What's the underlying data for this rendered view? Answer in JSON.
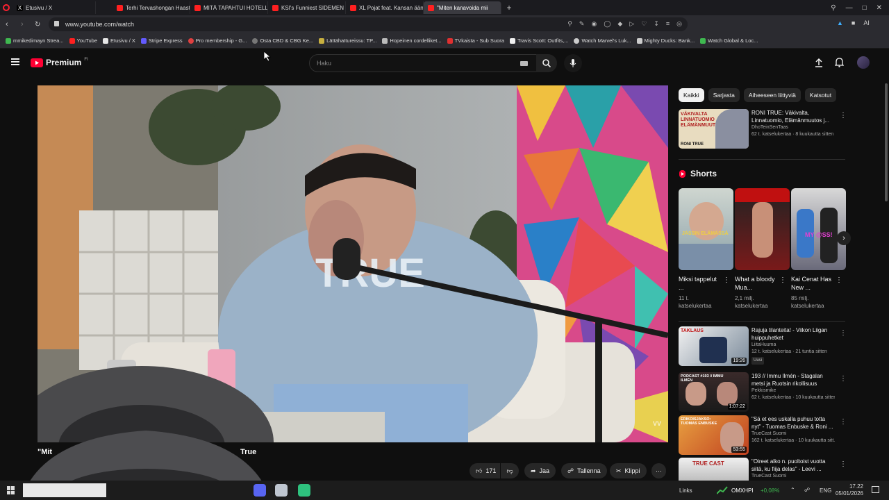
{
  "browser": {
    "tabs": [
      {
        "title": "Etusivu / X",
        "color": "#e6e6e6"
      },
      {
        "title": "Terhi Tervashongan Haasta",
        "color": "#ff2020"
      },
      {
        "title": "MITÄ TAPAHTUI HOTELLII",
        "color": "#ff2020"
      },
      {
        "title": "KSI's Funniest SIDEMEN M",
        "color": "#ff2020"
      },
      {
        "title": "XL Pojat feat. Kansan äänl",
        "color": "#ff2020"
      },
      {
        "title": "\"Miten kanavoida mii",
        "color": "#ff2020"
      }
    ],
    "new_tab": "+",
    "url": "www.youtube.com/watch",
    "bookmarks": [
      {
        "label": "mmikedimayn Strea...",
        "color": "#3fb950"
      },
      {
        "label": "YouTube",
        "color": "#ff2020"
      },
      {
        "label": "Etusivu / X",
        "color": "#e6e6e6"
      },
      {
        "label": "Stripe Express",
        "color": "#635bff"
      },
      {
        "label": "Pro membership - G...",
        "color": "#e04040"
      },
      {
        "label": "Osta CBD & CBG Ke...",
        "color": "#777777"
      },
      {
        "label": "Lättähattureissu: TP...",
        "color": "#c8b040"
      },
      {
        "label": "Hopeinen cordelliket...",
        "color": "#bbbbbb"
      },
      {
        "label": "TVkaista - Sub Suora",
        "color": "#e03030"
      },
      {
        "label": "Travis Scott: Outfits,...",
        "color": "#f1f1f1"
      },
      {
        "label": "Watch Marvel's Luk...",
        "color": "#cccccc"
      },
      {
        "label": "Mighty Ducks: Bank...",
        "color": "#cccccc"
      },
      {
        "label": "Watch Global & Loc...",
        "color": "#3fb950"
      }
    ]
  },
  "youtube": {
    "logo_text": "Premium",
    "logo_sup": "FI",
    "search_placeholder": "Haku",
    "video": {
      "title_left": "\"Mit",
      "title_right": "True",
      "like_count": "171",
      "share": "Jaa",
      "save": "Tallenna",
      "clip": "Klippi",
      "watermark": "VV"
    },
    "chips": [
      "Kaikki",
      "Sarjasta",
      "Aiheeseen liittyviä",
      "Katsotut"
    ],
    "recs_top": [
      {
        "title": "RONI TRUE: Väkivalta, Linnatuomio, Elämänmuutos j...",
        "channel": "DhoTeinSenTaas",
        "views": "62 t. katselukertaa · 8 kuukautta sitten",
        "thumb_text": "VÄKIVALTA LINNATUOMIO ELÄMÄNMUUTOS",
        "thumb_sub": "RONI TRUE"
      }
    ],
    "shorts_heading": "Shorts",
    "shorts": [
      {
        "title": "Miksi tappelut ...",
        "views": "11 t. katselukertaa",
        "thumb_text": "JÄSSIN ELÄMÄSSÄ"
      },
      {
        "title": "What a bloody Mua...",
        "views": "2,1 milj. katselukertaa",
        "thumb_text": ""
      },
      {
        "title": "Kai Cenat Has New ...",
        "views": "85 milj. katselukertaa",
        "thumb_text": "MY @SS!"
      }
    ],
    "recs": [
      {
        "title": "Rajuja tilanteita! - Viikon Liigan huippuhetket",
        "channel": "LiitaHuuma",
        "views": "12 t. katselukertaa · 21 tuntia sitten",
        "badge": "Uusi",
        "duration": "19:26",
        "thumb_text": "TAKLAUS"
      },
      {
        "title": "193 // Immu Ilmén - Stagalan metsi ja Ruotsin rikollisuus",
        "channel": "Pekkismike",
        "views": "62 t. katselukertaa · 10 kuukautta sitten",
        "duration": "1:07:22",
        "thumb_text": "PODCAST #193 // IMMU ILMÉN"
      },
      {
        "title": "\"Sä et ees uskalla puhuu totta nyt\" - Tuomas Enbuske & Roni ...",
        "channel": "TrueCast Suomi",
        "views": "162 t. katselukertaa · 10 kuukautta sitt...",
        "duration": "53:55",
        "thumb_text": "ERIKOISJAKSO: TUOMAS ENBUSKE"
      },
      {
        "title": "\"Oireet alko n. puoltoist vuotta siitä, ku fiija delas\" - Leevi ...",
        "channel": "TrueCast Suomi",
        "views": "",
        "duration": "",
        "thumb_text": "TRUE CAST"
      }
    ]
  },
  "taskbar": {
    "links": "Links",
    "ticker": "OMXHPI",
    "ticker_change": "+0,08%",
    "lang": "ENG",
    "time": "17.22",
    "date": "05/01/2026"
  },
  "colors": {
    "yt_red": "#ff0033",
    "accent_green": "#3fb950"
  }
}
